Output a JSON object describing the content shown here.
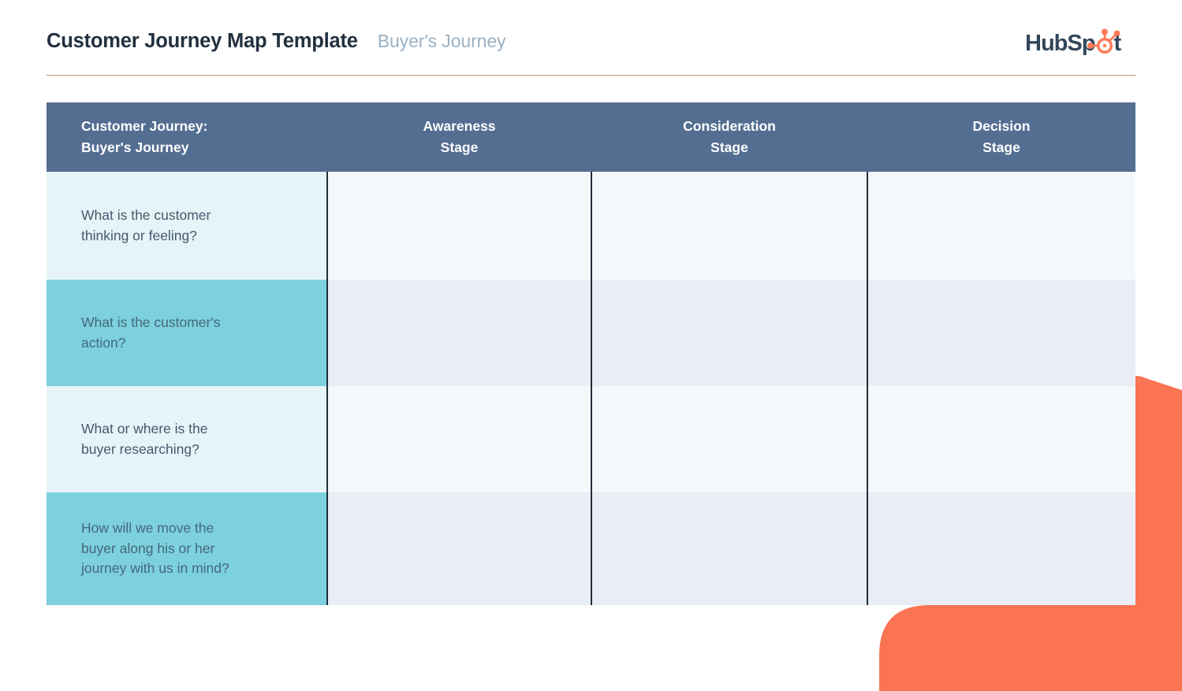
{
  "header": {
    "title": "Customer Journey Map Template",
    "subtitle": "Buyer's Journey",
    "brand": {
      "name": "HubSpot",
      "text_part1": "HubSp",
      "text_part2": "t",
      "logo_icon": "hubspot-sprocket-icon",
      "color_dark": "#33475b",
      "color_accent": "#ff7a59"
    },
    "rule_color": "#c98d80"
  },
  "table": {
    "header_bg": "#546e92",
    "header_text_color": "#ffffff",
    "divider_color": "#1f2d3a",
    "columns": [
      {
        "key": "label",
        "line1": "Customer Journey:",
        "line2": "Buyer's Journey",
        "align": "left"
      },
      {
        "key": "stage1",
        "line1": "Awareness",
        "line2": "Stage",
        "align": "center"
      },
      {
        "key": "stage2",
        "line1": "Consideration",
        "line2": "Stage",
        "align": "center"
      },
      {
        "key": "stage3",
        "line1": "Decision",
        "line2": "Stage",
        "align": "center"
      }
    ],
    "rows": [
      {
        "tint": "light",
        "label_bg": "#e6f3f8",
        "cell_bg": "#f5f8fb",
        "label_lines": [
          "What is the customer",
          "thinking or feeling?"
        ],
        "cells": [
          "",
          "",
          ""
        ]
      },
      {
        "tint": "dark",
        "label_bg": "#7dd0dd",
        "cell_bg": "#e9edf5",
        "label_lines": [
          "What is the customer's",
          "action?"
        ],
        "cells": [
          "",
          "",
          ""
        ]
      },
      {
        "tint": "light",
        "label_bg": "#e6f3f8",
        "cell_bg": "#f5f8fb",
        "label_lines": [
          "What or where is the",
          "buyer researching?"
        ],
        "cells": [
          "",
          "",
          ""
        ]
      },
      {
        "tint": "dark",
        "label_bg": "#7dd0dd",
        "cell_bg": "#e9edf5",
        "label_lines": [
          "How will we move the",
          "buyer along his or her",
          "journey with us in mind?"
        ],
        "cells": [
          "",
          "",
          ""
        ]
      }
    ]
  },
  "decoration": {
    "shape_name": "orange-corner-accent",
    "color": "#fa7353"
  }
}
